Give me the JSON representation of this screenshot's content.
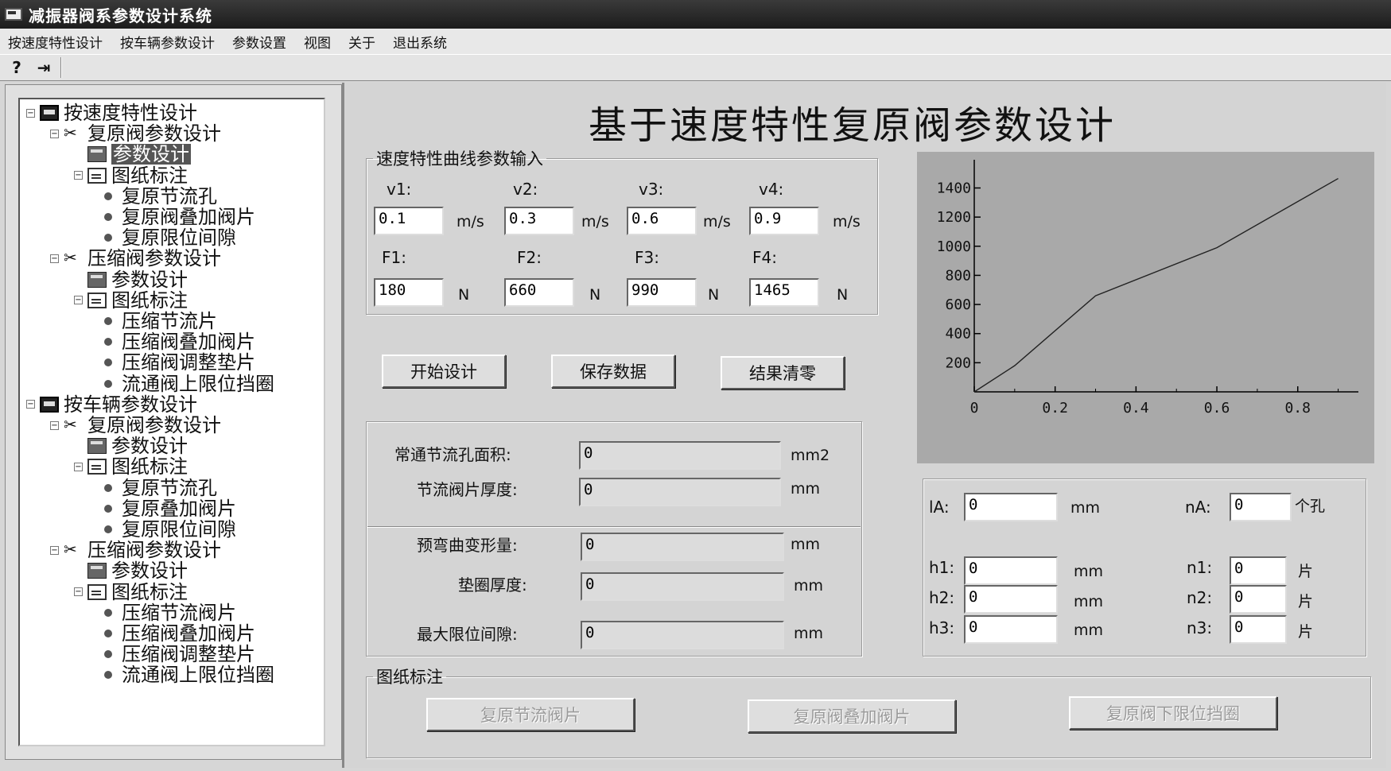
{
  "window": {
    "title": "减振器阀系参数设计系统"
  },
  "menu": [
    "按速度特性设计",
    "按车辆参数设计",
    "参数设置",
    "视图",
    "关于",
    "退出系统"
  ],
  "toolbar": {
    "icons": [
      "help-icon",
      "exit-icon"
    ],
    "help_glyph": "?",
    "exit_glyph": "⇥"
  },
  "tree": {
    "expander_glyph": "−",
    "items": [
      {
        "label": "按速度特性设计",
        "level": 0,
        "icon": "window"
      },
      {
        "label": "复原阀参数设计",
        "level": 1,
        "icon": "tools"
      },
      {
        "label": "参数设计",
        "level": 2,
        "icon": "calc",
        "selected": true
      },
      {
        "label": "图纸标注",
        "level": 2,
        "icon": "doc"
      },
      {
        "label": "复原节流孔",
        "level": 3,
        "icon": "bullet"
      },
      {
        "label": "复原阀叠加阀片",
        "level": 3,
        "icon": "bullet"
      },
      {
        "label": "复原限位间隙",
        "level": 3,
        "icon": "bullet"
      },
      {
        "label": "压缩阀参数设计",
        "level": 1,
        "icon": "tools"
      },
      {
        "label": "参数设计",
        "level": 2,
        "icon": "calc"
      },
      {
        "label": "图纸标注",
        "level": 2,
        "icon": "doc"
      },
      {
        "label": "压缩节流片",
        "level": 3,
        "icon": "bullet"
      },
      {
        "label": "压缩阀叠加阀片",
        "level": 3,
        "icon": "bullet"
      },
      {
        "label": "压缩阀调整垫片",
        "level": 3,
        "icon": "bullet"
      },
      {
        "label": "流通阀上限位挡圈",
        "level": 3,
        "icon": "bullet"
      },
      {
        "label": "按车辆参数设计",
        "level": 0,
        "icon": "window"
      },
      {
        "label": "复原阀参数设计",
        "level": 1,
        "icon": "tools"
      },
      {
        "label": "参数设计",
        "level": 2,
        "icon": "calc"
      },
      {
        "label": "图纸标注",
        "level": 2,
        "icon": "doc"
      },
      {
        "label": "复原节流孔",
        "level": 3,
        "icon": "bullet"
      },
      {
        "label": "复原叠加阀片",
        "level": 3,
        "icon": "bullet"
      },
      {
        "label": "复原限位间隙",
        "level": 3,
        "icon": "bullet"
      },
      {
        "label": "压缩阀参数设计",
        "level": 1,
        "icon": "tools"
      },
      {
        "label": "参数设计",
        "level": 2,
        "icon": "calc"
      },
      {
        "label": "图纸标注",
        "level": 2,
        "icon": "doc"
      },
      {
        "label": "压缩节流阀片",
        "level": 3,
        "icon": "bullet"
      },
      {
        "label": "压缩阀叠加阀片",
        "level": 3,
        "icon": "bullet"
      },
      {
        "label": "压缩阀调整垫片",
        "level": 3,
        "icon": "bullet"
      },
      {
        "label": "流通阀上限位挡圈",
        "level": 3,
        "icon": "bullet"
      }
    ]
  },
  "main": {
    "title": "基于速度特性复原阀参数设计",
    "input_group": {
      "legend": "速度特性曲线参数输入",
      "velocity": [
        {
          "label": "v1:",
          "value": "0.1",
          "unit": "m/s"
        },
        {
          "label": "v2:",
          "value": "0.3",
          "unit": "m/s"
        },
        {
          "label": "v3:",
          "value": "0.6",
          "unit": "m/s"
        },
        {
          "label": "v4:",
          "value": "0.9",
          "unit": "m/s"
        }
      ],
      "force": [
        {
          "label": "F1:",
          "value": "180",
          "unit": "N"
        },
        {
          "label": "F2:",
          "value": "660",
          "unit": "N"
        },
        {
          "label": "F3:",
          "value": "990",
          "unit": "N"
        },
        {
          "label": "F4:",
          "value": "1465",
          "unit": "N"
        }
      ]
    },
    "buttons": {
      "start": "开始设计",
      "save": "保存数据",
      "clear": "结果清零"
    },
    "results": [
      {
        "label": "常通节流孔面积:",
        "value": "0",
        "unit": "mm2"
      },
      {
        "label": "节流阀片厚度:",
        "value": "0",
        "unit": "mm"
      },
      {
        "label": "预弯曲变形量:",
        "value": "0",
        "unit": "mm"
      },
      {
        "label": "垫圈厚度:",
        "value": "0",
        "unit": "mm"
      },
      {
        "label": "最大限位间隙:",
        "value": "0",
        "unit": "mm"
      }
    ],
    "holes": {
      "lA": {
        "label": "lA:",
        "value": "0",
        "unit": "mm"
      },
      "nA": {
        "label": "nA:",
        "value": "0",
        "unit": "个孔"
      },
      "h": [
        {
          "label": "h1:",
          "value": "0",
          "unit": "mm"
        },
        {
          "label": "h2:",
          "value": "0",
          "unit": "mm"
        },
        {
          "label": "h3:",
          "value": "0",
          "unit": "mm"
        }
      ],
      "n": [
        {
          "label": "n1:",
          "value": "0",
          "unit": "片"
        },
        {
          "label": "n2:",
          "value": "0",
          "unit": "片"
        },
        {
          "label": "n3:",
          "value": "0",
          "unit": "片"
        }
      ]
    },
    "drawing_group": {
      "legend": "图纸标注",
      "buttons": [
        "复原节流阀片",
        "复原阀叠加阀片",
        "复原阀下限位挡圈"
      ]
    }
  },
  "colors": {
    "chart_bg": "#a9a9a9",
    "line": "#222222"
  },
  "chart_data": {
    "type": "line",
    "x": [
      0,
      0.1,
      0.3,
      0.6,
      0.9
    ],
    "y": [
      0,
      180,
      660,
      990,
      1465
    ],
    "xlim": [
      0,
      0.95
    ],
    "ylim": [
      0,
      1550
    ],
    "xticks": [
      0,
      0.2,
      0.4,
      0.6,
      0.8
    ],
    "xtick_labels": [
      "0",
      "0.2",
      "0.4",
      "0.6",
      "0.8"
    ],
    "yticks": [
      200,
      400,
      600,
      800,
      1000,
      1200,
      1400
    ],
    "grid": false
  }
}
